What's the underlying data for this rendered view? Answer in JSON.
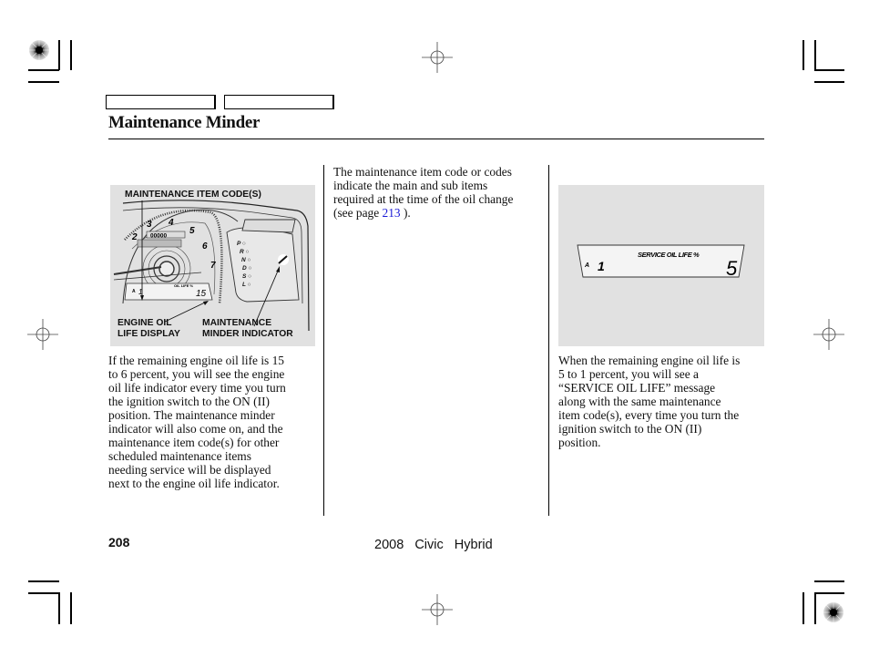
{
  "header": {
    "tabs": [
      "",
      ""
    ],
    "title": "Maintenance Minder"
  },
  "figure_left": {
    "callouts": {
      "top": "MAINTENANCE ITEM CODE(S)",
      "bottom_left": "ENGINE OIL\nLIFE DISPLAY",
      "bottom_right": "MAINTENANCE\nMINDER INDICATOR"
    },
    "gauge": {
      "tach_numbers": [
        "2",
        "3",
        "4",
        "5",
        "6",
        "7"
      ],
      "gear_letters": [
        "P",
        "R",
        "N",
        "D",
        "S",
        "L"
      ],
      "odometer": "00000",
      "display_code_letter": "A",
      "display_code_number": "1",
      "display_label": "OIL LIFE %",
      "display_value": "15"
    }
  },
  "figure_right": {
    "display_code_letter": "A",
    "display_code_number": "1",
    "display_label": "SERVICE OIL LIFE %",
    "display_value": "5"
  },
  "columns": {
    "left": "If the remaining engine oil life is 15\nto 6 percent, you will see the engine\noil life indicator every time you turn\nthe ignition switch to the ON (II)\nposition. The maintenance minder\nindicator will also come on, and the\nmaintenance item code(s) for other\nscheduled maintenance items\nneeding service will be displayed\nnext to the engine oil life indicator.",
    "middle_before_link": "The maintenance item code or codes\nindicate the main and sub items\nrequired at the time of the oil change\n(see page ",
    "middle_link": "213",
    "middle_after_link": " ).",
    "right": "When the remaining engine oil life is\n5 to 1 percent, you will see a\n“SERVICE OIL LIFE” message\nalong with the same maintenance\nitem code(s), every time you turn the\nignition switch to the ON (II)\nposition."
  },
  "footer": {
    "page_number": "208",
    "book_title": "2008  Civic  Hybrid"
  }
}
